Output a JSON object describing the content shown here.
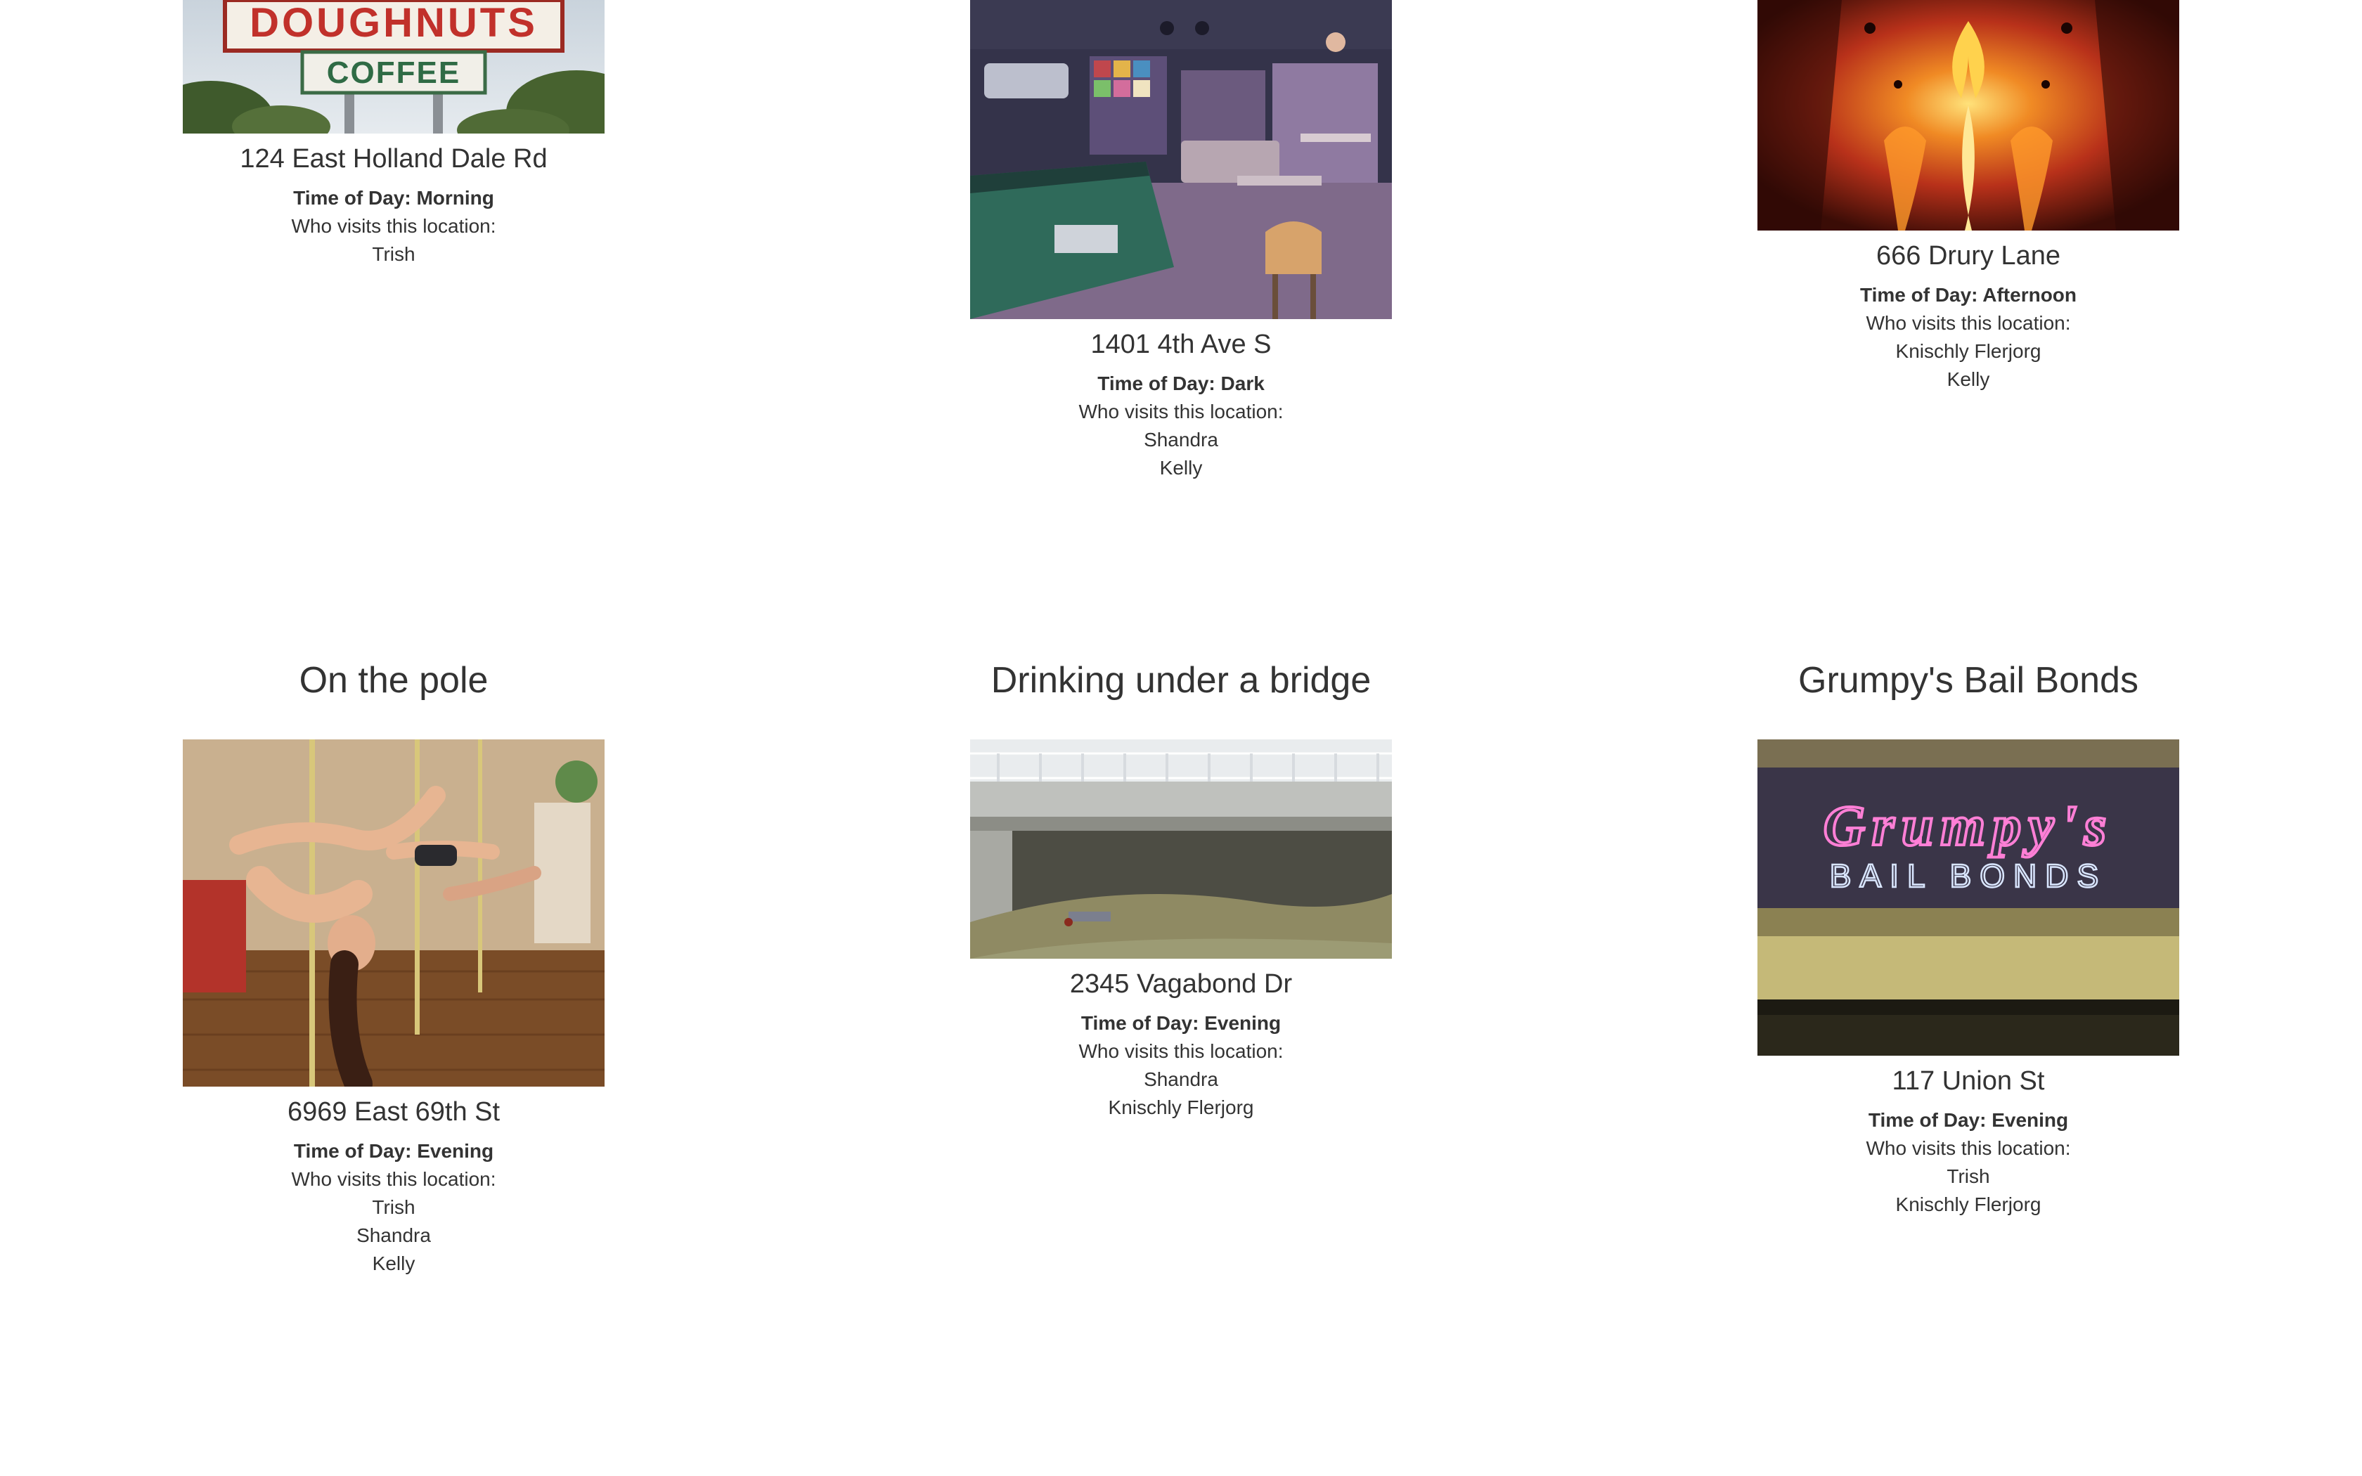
{
  "locations": [
    {
      "address": "124 East Holland Dale Rd",
      "time_of_day": "Time of Day: Morning",
      "visitors_label": "Who visits this location:",
      "visitors": [
        "Trish"
      ],
      "image": {
        "sign_top": "DOUGHNUTS",
        "sign_bottom": "COFFEE"
      }
    },
    {
      "address": "1401 4th Ave S",
      "time_of_day": "Time of Day: Dark",
      "visitors_label": "Who visits this location:",
      "visitors": [
        "Shandra",
        "Kelly"
      ]
    },
    {
      "address": "666 Drury Lane",
      "time_of_day": "Time of Day: Afternoon",
      "visitors_label": "Who visits this location:",
      "visitors": [
        "Knischly Flerjorg",
        "Kelly"
      ]
    },
    {
      "title": "On the pole",
      "address": "6969 East 69th St",
      "time_of_day": "Time of Day: Evening",
      "visitors_label": "Who visits this location:",
      "visitors": [
        "Trish",
        "Shandra",
        "Kelly"
      ]
    },
    {
      "title": "Drinking under a bridge",
      "address": "2345 Vagabond Dr",
      "time_of_day": "Time of Day: Evening",
      "visitors_label": "Who visits this location:",
      "visitors": [
        "Shandra",
        "Knischly Flerjorg"
      ]
    },
    {
      "title": "Grumpy's Bail Bonds",
      "address": "117 Union St",
      "time_of_day": "Time of Day: Evening",
      "visitors_label": "Who visits this location:",
      "visitors": [
        "Trish",
        "Knischly Flerjorg"
      ],
      "image": {
        "sign_top": "Grumpy's",
        "sign_bottom": "BAIL BONDS"
      }
    }
  ]
}
